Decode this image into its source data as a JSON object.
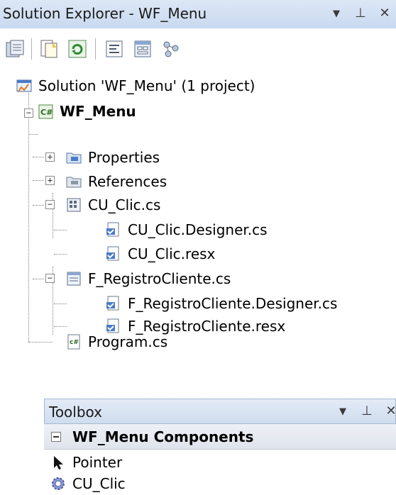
{
  "solution_explorer": {
    "title": "Solution Explorer - WF_Menu",
    "window_buttons": {
      "dropdown": "▼",
      "pin": "⊥",
      "close": "✕"
    },
    "toolbar_icons": [
      "properties-icon",
      "show-all-files-icon",
      "refresh-icon",
      "view-code-icon",
      "view-designer-icon",
      "class-view-icon"
    ],
    "tree": {
      "solution": "Solution 'WF_Menu' (1 project)",
      "project": "WF_Menu",
      "items": [
        {
          "label": "Properties",
          "icon": "properties-folder-icon"
        },
        {
          "label": "References",
          "icon": "references-folder-icon"
        },
        {
          "label": "CU_Clic.cs",
          "icon": "user-control-icon"
        },
        {
          "label": "CU_Clic.Designer.cs",
          "icon": "designer-file-icon"
        },
        {
          "label": "CU_Clic.resx",
          "icon": "resx-file-icon"
        },
        {
          "label": "F_RegistroCliente.cs",
          "icon": "form-icon"
        },
        {
          "label": "F_RegistroCliente.Designer.cs",
          "icon": "designer-file-icon"
        },
        {
          "label": "F_RegistroCliente.resx",
          "icon": "resx-file-icon"
        },
        {
          "label": "Program.cs",
          "icon": "csharp-file-icon"
        }
      ]
    }
  },
  "toolbox": {
    "title": "Toolbox",
    "window_buttons": {
      "dropdown": "▼",
      "pin": "⊥",
      "close": "✕"
    },
    "group_label": "WF_Menu Components",
    "items": [
      {
        "label": "Pointer",
        "icon": "pointer-icon"
      },
      {
        "label": "CU_Clic",
        "icon": "component-gear-icon"
      }
    ]
  }
}
